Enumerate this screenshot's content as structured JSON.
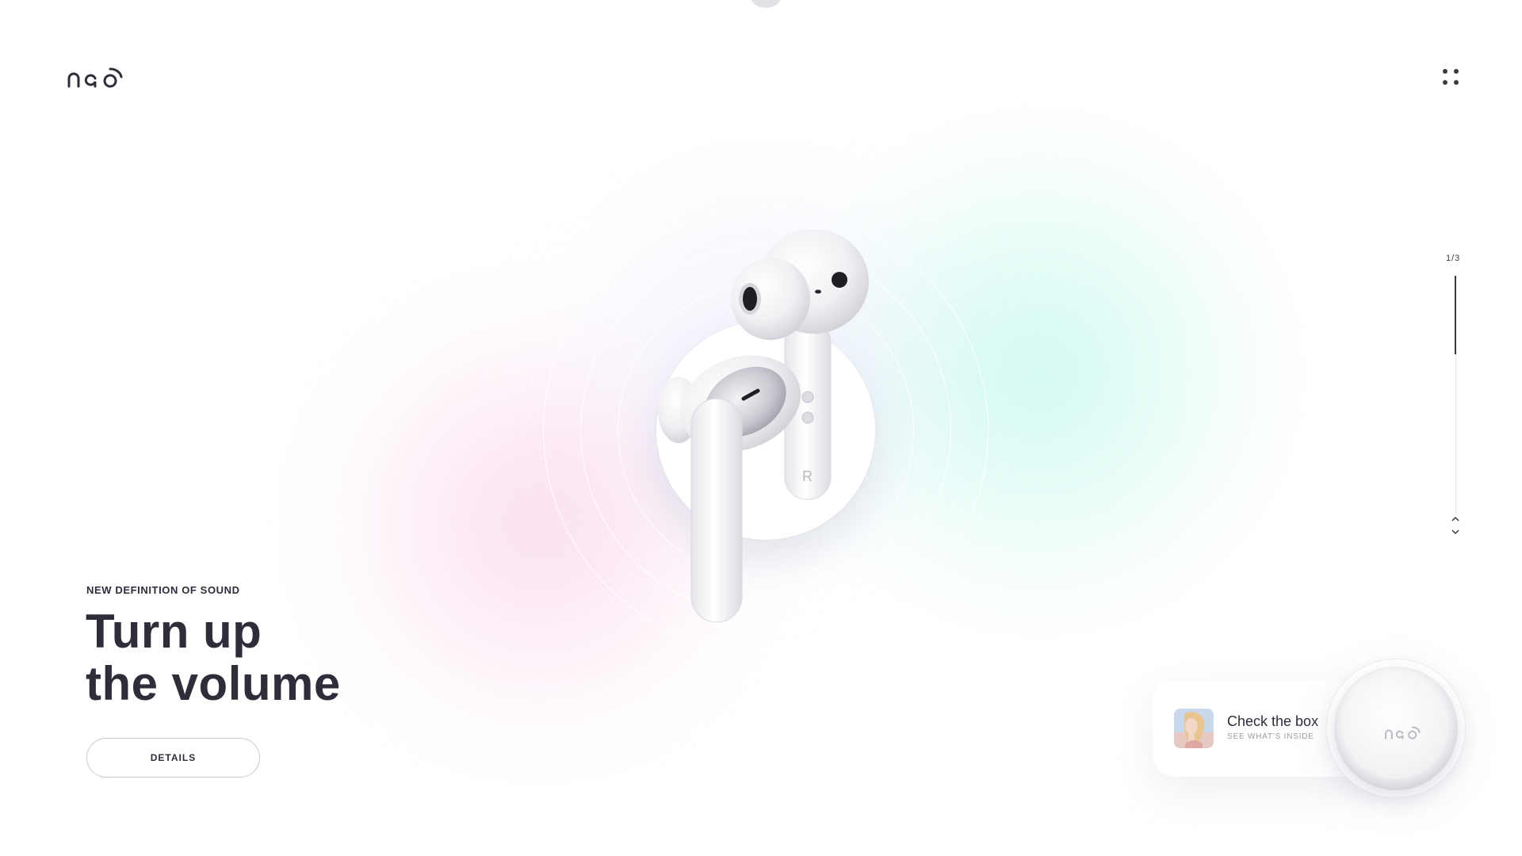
{
  "brand": {
    "logo_text": "nao"
  },
  "header": {
    "menu_icon": "grid-dots-icon"
  },
  "hero": {
    "eyebrow": "NEW DEFINITION OF SOUND",
    "headline_line1": "Turn up",
    "headline_line2": "the volume",
    "details_label": "DETAILS"
  },
  "product": {
    "earbud_marking": "R"
  },
  "pager": {
    "count": "1/3",
    "up_icon": "chevron-up-icon",
    "down_icon": "chevron-down-icon",
    "progress": 0.33
  },
  "promo": {
    "title": "Check the box",
    "subtitle": "SEE WHAT'S INSIDE",
    "case_logo_text": "nao"
  },
  "colors": {
    "text_dark": "#2f2d3a",
    "glow_pink": "#facde6",
    "glow_mint": "#b4f5e6",
    "background": "#ffffff"
  }
}
